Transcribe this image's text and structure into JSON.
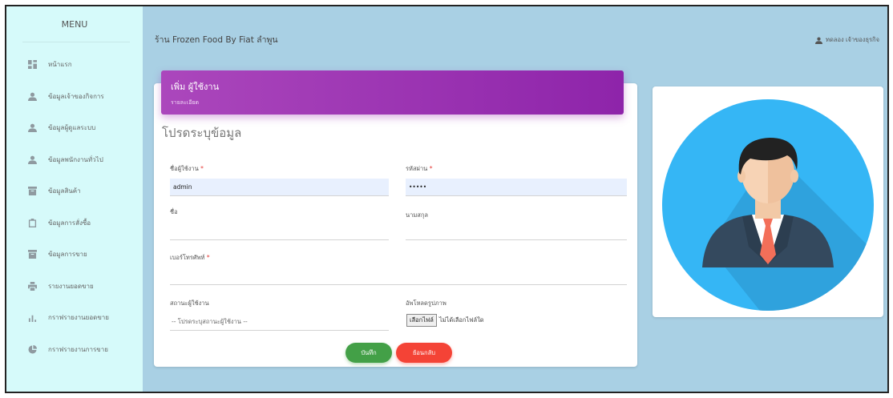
{
  "sidebar": {
    "title": "MENU",
    "items": [
      {
        "label": "หน้าแรก",
        "icon": "dashboard-icon"
      },
      {
        "label": "ข้อมูลเจ้าของกิจการ",
        "icon": "person-icon"
      },
      {
        "label": "ข้อมูลผู้ดูแลระบบ",
        "icon": "person-icon"
      },
      {
        "label": "ข้อมูลพนักงานทั่วไป",
        "icon": "person-icon"
      },
      {
        "label": "ข้อมูลสินค้า",
        "icon": "archive-icon"
      },
      {
        "label": "ข้อมูลการสั่งซื้อ",
        "icon": "clipboard-icon"
      },
      {
        "label": "ข้อมูลการขาย",
        "icon": "archive-icon"
      },
      {
        "label": "รายงานยอดขาย",
        "icon": "print-icon"
      },
      {
        "label": "กราฟรายงานยอดขาย",
        "icon": "bar-chart-icon"
      },
      {
        "label": "กราฟรายงานการขาย",
        "icon": "pie-chart-icon"
      }
    ]
  },
  "header": {
    "title": "ร้าน Frozen Food By Fiat ลำพูน",
    "user": "ทดลอง เจ้าของธุรกิจ"
  },
  "card": {
    "title": "เพิ่ม ผู้ใช้งาน",
    "subtitle": "รายละเอียด",
    "heading": "โปรดระบุข้อมูล"
  },
  "form": {
    "username_label": "ชื่อผู้ใช้งาน",
    "username_value": "admin",
    "password_label": "รหัสผ่าน",
    "password_value": "•••••",
    "firstname_label": "ชื่อ",
    "firstname_value": "",
    "lastname_label": "นามสกุล",
    "lastname_value": "",
    "phone_label": "เบอร์โทรศัพท์",
    "phone_value": "",
    "status_label": "สถานะผู้ใช้งาน",
    "status_value": "-- โปรดระบุสถานะผู้ใช้งาน --",
    "upload_label": "อัพโหลดรูปภาพ",
    "file_button": "เลือกไฟล์",
    "file_status": "ไม่ได้เลือกไฟล์ใด",
    "required_mark": "*"
  },
  "buttons": {
    "save": "บันทึก",
    "back": "ย้อนกลับ"
  },
  "colors": {
    "header_purple": "#9c27b0",
    "save_green": "#43a047",
    "back_red": "#f44336",
    "avatar_blue": "#35b6f5"
  }
}
